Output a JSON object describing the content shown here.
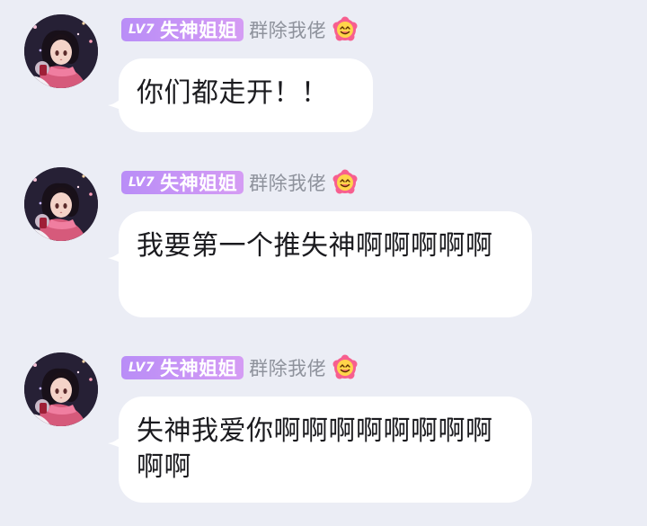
{
  "messages": [
    {
      "level": "LV7",
      "title": "失神姐姐",
      "nickname": "群除我佬",
      "badge_icon": "flower-face-icon",
      "text": "你们都走开！！"
    },
    {
      "level": "LV7",
      "title": "失神姐姐",
      "nickname": "群除我佬",
      "badge_icon": "flower-face-icon",
      "text": "我要第一个推失神啊啊啊啊啊"
    },
    {
      "level": "LV7",
      "title": "失神姐姐",
      "nickname": "群除我佬",
      "badge_icon": "flower-face-icon",
      "text": "失神我爱你啊啊啊啊啊啊啊啊啊啊"
    }
  ],
  "colors": {
    "background": "#ebedf5",
    "bubble": "#ffffff",
    "level_tag_start": "#b98df7",
    "level_tag_end": "#d59cf4",
    "nickname": "#8e929c",
    "message_text": "#1b1b1f"
  }
}
